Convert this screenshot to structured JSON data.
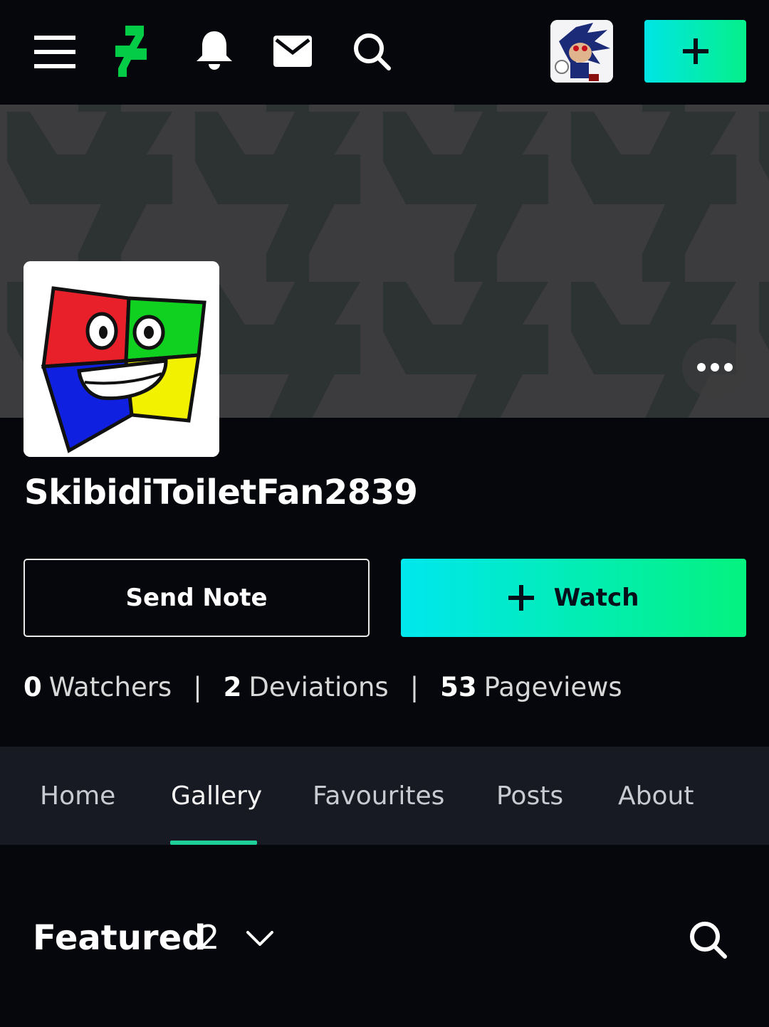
{
  "header": {
    "menu_icon": "hamburger-menu-icon",
    "logo_icon": "deviantart-logo-icon",
    "notifications_icon": "bell-icon",
    "messages_icon": "mail-icon",
    "search_icon": "search-icon",
    "submit_icon": "plus-icon",
    "avatar_alt": "user avatar"
  },
  "profile": {
    "username": "SkibidiToiletFan2839",
    "send_note_label": "Send Note",
    "watch_label": "Watch",
    "more_icon": "more-horizontal-icon"
  },
  "stats": {
    "watchers_count": "0",
    "watchers_label": "Watchers",
    "deviations_count": "2",
    "deviations_label": "Deviations",
    "pageviews_count": "53",
    "pageviews_label": "Pageviews",
    "separator": "|"
  },
  "tabs": [
    {
      "label": "Home",
      "active": false
    },
    {
      "label": "Gallery",
      "active": true
    },
    {
      "label": "Favourites",
      "active": false
    },
    {
      "label": "Posts",
      "active": false
    },
    {
      "label": "About",
      "active": false
    }
  ],
  "featured": {
    "title": "Featured",
    "count": "2"
  },
  "colors": {
    "background": "#06070d",
    "accent_gradient_start": "#00e5e5",
    "accent_gradient_end": "#05f08a",
    "tab_underline": "#1fcf9a",
    "tab_bar": "#171a22",
    "banner": "#3c3c3e"
  }
}
